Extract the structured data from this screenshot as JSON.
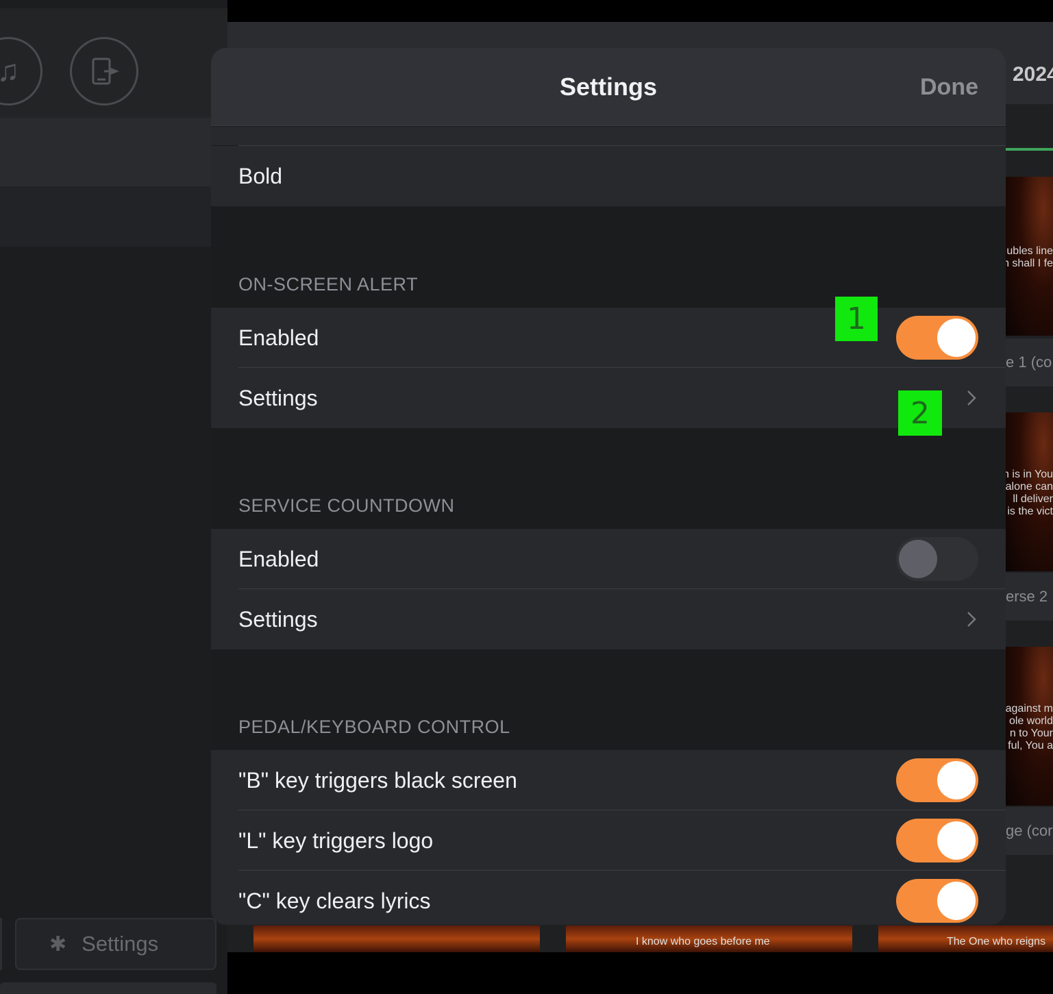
{
  "background": {
    "left_settings_label": "Settings",
    "year_text": "2024",
    "thumbnail_texts": [
      [
        "ubles line",
        "n shall I fe"
      ],
      [
        "n is in You",
        "alone can",
        "ll deliver",
        "is the vict"
      ],
      [
        "against m",
        "ole world",
        "n to Your",
        "ful, You a"
      ]
    ],
    "verse_labels": [
      "e 1 (co",
      "erse 2",
      "ge (cor"
    ],
    "bottom_texts": [
      "I know who goes before me",
      "The One who reigns"
    ]
  },
  "modal": {
    "title": "Settings",
    "done_label": "Done",
    "font_weight_row": "Bold",
    "sections": [
      {
        "header": "ON-SCREEN ALERT",
        "enabled_label": "Enabled",
        "enabled": true,
        "settings_label": "Settings"
      },
      {
        "header": "SERVICE COUNTDOWN",
        "enabled_label": "Enabled",
        "enabled": false,
        "settings_label": "Settings"
      },
      {
        "header": "PEDAL/KEYBOARD CONTROL",
        "rows": [
          {
            "label": "\"B\" key triggers black screen",
            "on": true
          },
          {
            "label": "\"L\" key triggers logo",
            "on": true
          },
          {
            "label": "\"C\" key clears lyrics",
            "on": true
          }
        ]
      }
    ]
  },
  "annotations": [
    "1",
    "2"
  ],
  "colors": {
    "accent_toggle": "#f78d3c",
    "badge_green": "#11e80e"
  },
  "icons": [
    "music-note-icon",
    "display-exit-icon",
    "gear-icon",
    "chevron-right-icon"
  ]
}
